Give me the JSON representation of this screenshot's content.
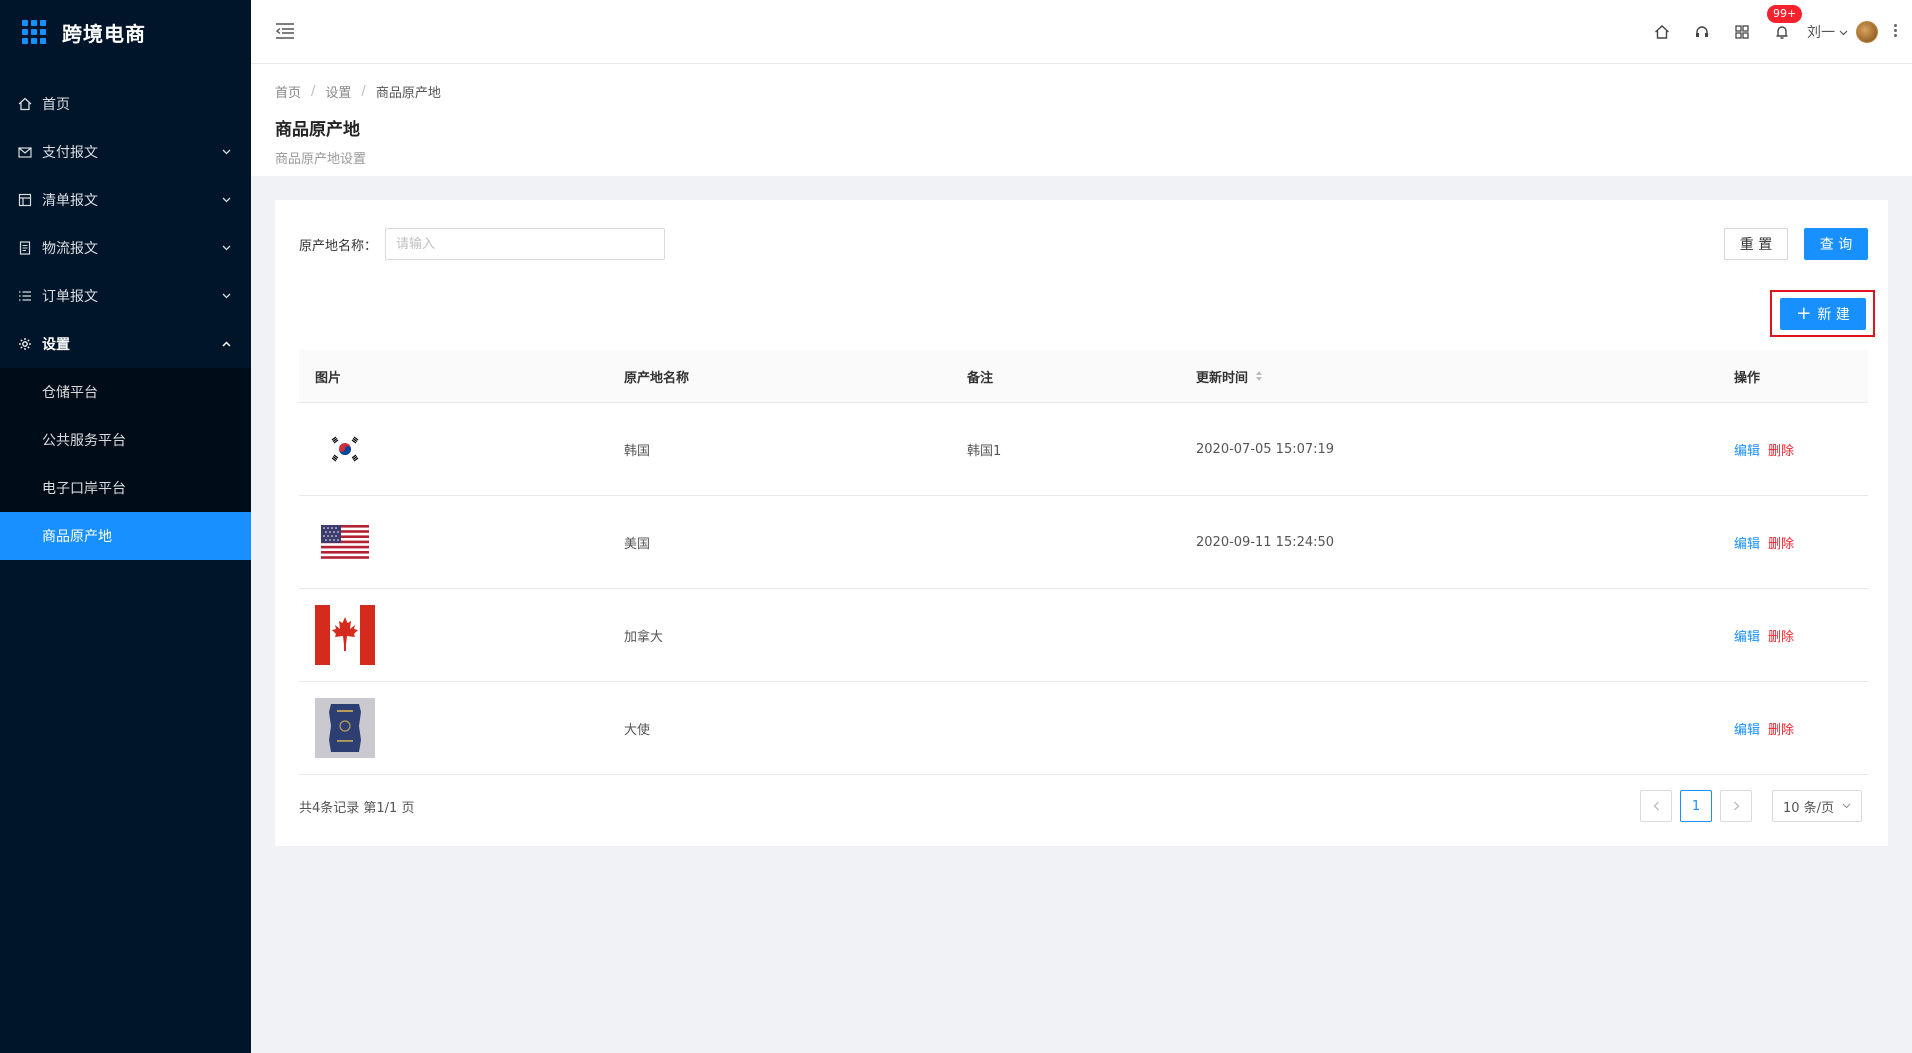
{
  "app": {
    "title": "跨境电商"
  },
  "sidebar": {
    "items": [
      {
        "label": "首页",
        "icon": "home-icon"
      },
      {
        "label": "支付报文",
        "icon": "mail-icon"
      },
      {
        "label": "清单报文",
        "icon": "table-icon"
      },
      {
        "label": "物流报文",
        "icon": "file-icon"
      },
      {
        "label": "订单报文",
        "icon": "list-icon"
      },
      {
        "label": "设置",
        "icon": "gear-icon"
      }
    ],
    "submenu": [
      {
        "label": "仓储平台"
      },
      {
        "label": "公共服务平台"
      },
      {
        "label": "电子口岸平台"
      },
      {
        "label": "商品原产地",
        "active": true
      }
    ]
  },
  "header": {
    "badge": "99+",
    "user_name": "刘一"
  },
  "breadcrumb": [
    "首页",
    "设置",
    "商品原产地"
  ],
  "page": {
    "title": "商品原产地",
    "subtitle": "商品原产地设置"
  },
  "search": {
    "label": "原产地名称：",
    "placeholder": "请输入",
    "value": ""
  },
  "buttons": {
    "reset": "重 置",
    "query": "查 询",
    "new": "新 建"
  },
  "table": {
    "columns": [
      "图片",
      "原产地名称",
      "备注",
      "更新时间",
      "操作"
    ],
    "rows": [
      {
        "flag": "korea-flag",
        "name": "韩国",
        "note": "韩国1",
        "updated": "2020-07-05 15:07:19"
      },
      {
        "flag": "usa-flag",
        "name": "美国",
        "note": "",
        "updated": "2020-09-11 15:24:50"
      },
      {
        "flag": "canada-flag",
        "name": "加拿大",
        "note": "",
        "updated": ""
      },
      {
        "flag": "passport-image",
        "name": "大使",
        "note": "",
        "updated": ""
      }
    ],
    "actions": {
      "edit": "编辑",
      "delete": "删除"
    }
  },
  "footer": {
    "total": "共4条记录 第1/1 页",
    "current_page": "1",
    "page_size": "10 条/页"
  },
  "colors": {
    "sidebar_bg": "#001529",
    "primary": "#1890ff",
    "danger": "#f5222d",
    "highlight": "#e0141e"
  }
}
